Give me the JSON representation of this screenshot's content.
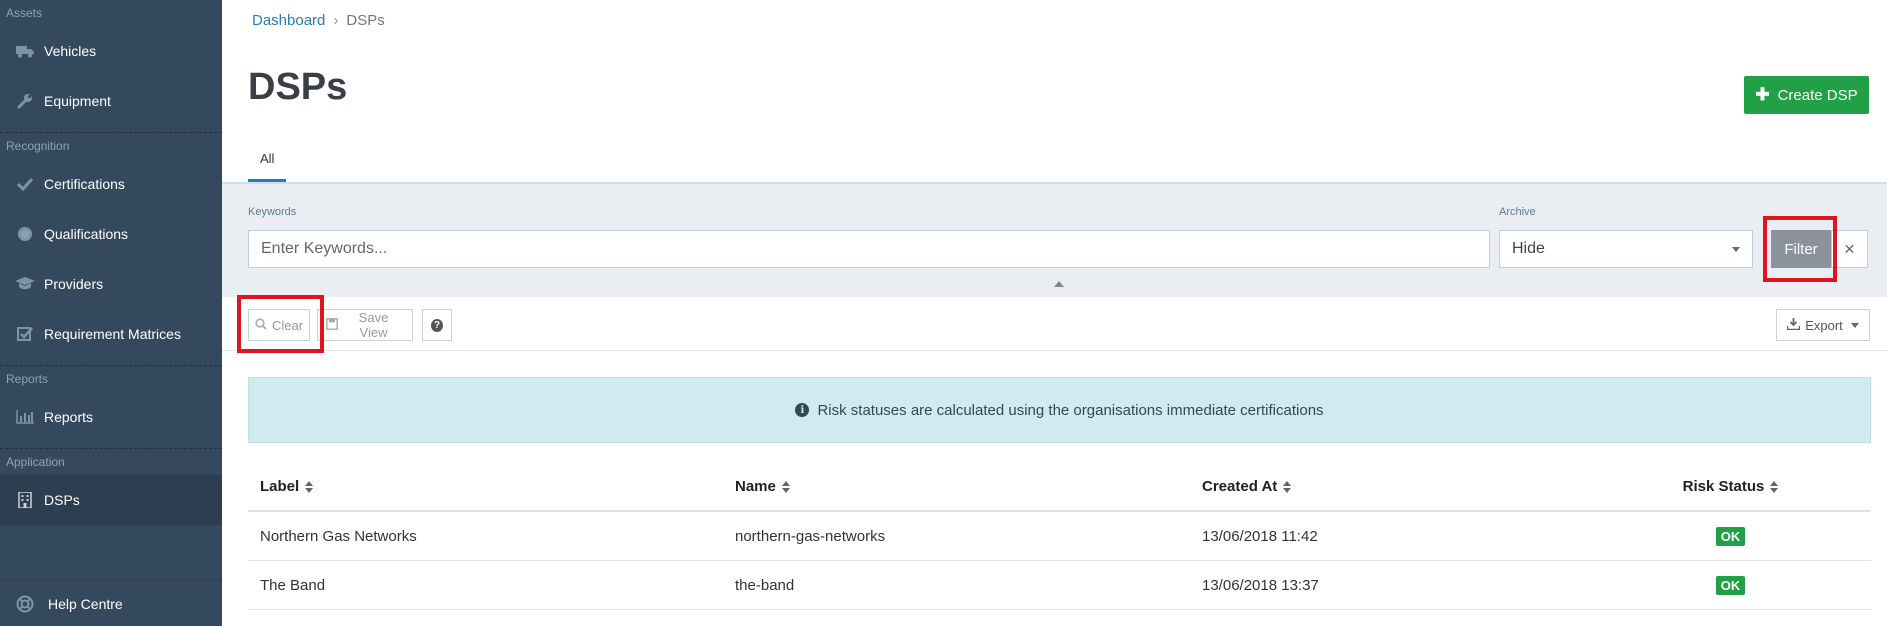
{
  "sidebar": {
    "sections": [
      {
        "title": "Assets",
        "items": [
          {
            "label": "Vehicles",
            "icon": "truck-icon"
          },
          {
            "label": "Equipment",
            "icon": "wrench-icon"
          }
        ]
      },
      {
        "title": "Recognition",
        "items": [
          {
            "label": "Certifications",
            "icon": "check-icon"
          },
          {
            "label": "Qualifications",
            "icon": "certificate-icon"
          },
          {
            "label": "Providers",
            "icon": "graduation-cap-icon"
          },
          {
            "label": "Requirement Matrices",
            "icon": "checkbox-icon"
          }
        ]
      },
      {
        "title": "Reports",
        "items": [
          {
            "label": "Reports",
            "icon": "bar-chart-icon"
          }
        ]
      },
      {
        "title": "Application",
        "items": [
          {
            "label": "DSPs",
            "icon": "building-icon",
            "active": true
          }
        ]
      }
    ],
    "help_label": "Help Centre"
  },
  "breadcrumb": {
    "home": "Dashboard",
    "current": "DSPs"
  },
  "page": {
    "title": "DSPs",
    "create_label": "Create DSP"
  },
  "tabs": [
    {
      "label": "All",
      "active": true
    }
  ],
  "filters": {
    "keywords_label": "Keywords",
    "keywords_placeholder": "Enter Keywords...",
    "archive_label": "Archive",
    "archive_value": "Hide",
    "filter_label": "Filter",
    "clear_x": "✕"
  },
  "toolbar": {
    "clear_label": "Clear",
    "save_view_label": "Save View",
    "help_label": "?",
    "export_label": "Export"
  },
  "info": {
    "message": "Risk statuses are calculated using the organisations immediate certifications"
  },
  "table": {
    "columns": [
      "Label",
      "Name",
      "Created At",
      "Risk Status"
    ],
    "rows": [
      {
        "label": "Northern Gas Networks",
        "name": "northern-gas-networks",
        "created_at": "13/06/2018 11:42",
        "risk": "OK"
      },
      {
        "label": "The Band",
        "name": "the-band",
        "created_at": "13/06/2018 13:37",
        "risk": "OK"
      }
    ]
  },
  "colors": {
    "sidebar_bg": "#34495e",
    "accent": "#2a7ab9",
    "success": "#21a046",
    "highlight": "#e0141e",
    "info_bg": "#d0eaef"
  }
}
